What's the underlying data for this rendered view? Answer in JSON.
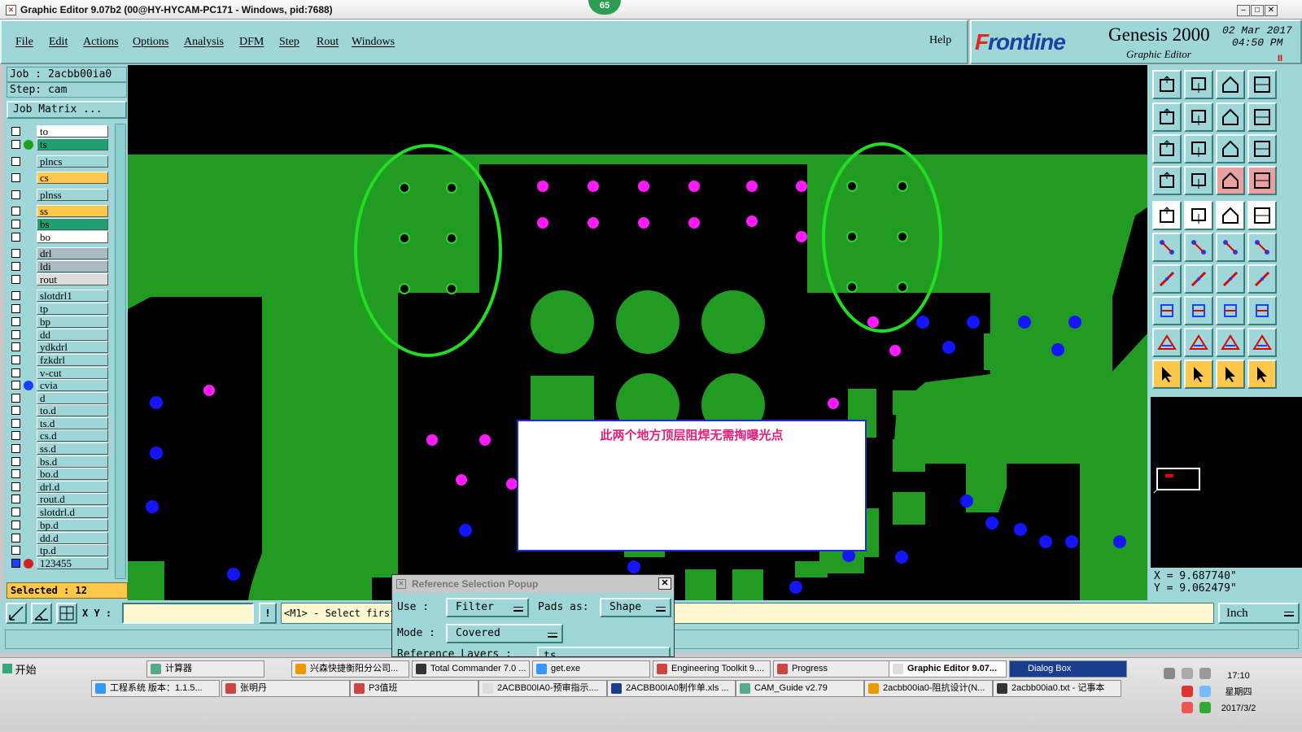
{
  "window": {
    "title": "Graphic Editor 9.07b2 (00@HY-HYCAM-PC171 - Windows, pid:7688)",
    "badge": "65"
  },
  "menu": [
    "File",
    "Edit",
    "Actions",
    "Options",
    "Analysis",
    "DFM",
    "Step",
    "Rout",
    "Windows"
  ],
  "help": "Help",
  "brand": {
    "logo_prefix": "F",
    "logo_rest": "rontline",
    "product": "Genesis 2000",
    "subtitle": "Graphic Editor",
    "date": "02 Mar 2017",
    "time": "04:50 PM",
    "pause": "II"
  },
  "job": {
    "job": "Job : 2acbb00ia0",
    "step": "Step: cam",
    "matrix": "Job Matrix ..."
  },
  "layers": [
    {
      "name": "to",
      "bg": "#ffffff",
      "dot": "",
      "edit": true
    },
    {
      "name": "ts",
      "bg": "#20a070",
      "dot": "#20a020",
      "edit": false
    },
    {
      "name": "plncs",
      "bg": "#9fd7d8",
      "dot": "",
      "edit": false
    },
    {
      "name": "cs",
      "bg": "#ffc84a",
      "dot": "",
      "edit": true
    },
    {
      "name": "plnss",
      "bg": "#9fd7d8",
      "dot": "",
      "edit": false
    },
    {
      "name": "ss",
      "bg": "#ffc84a",
      "dot": "",
      "edit": false
    },
    {
      "name": "bs",
      "bg": "#20a070",
      "dot": "",
      "edit": false
    },
    {
      "name": "bo",
      "bg": "#ffffff",
      "dot": "",
      "edit": false
    },
    {
      "name": "drl",
      "bg": "#a9bcc4",
      "dot": "",
      "edit": false
    },
    {
      "name": "ldi",
      "bg": "#a9bcc4",
      "dot": "",
      "edit": false
    },
    {
      "name": "rout",
      "bg": "#dcdcdc",
      "dot": "",
      "edit": false
    },
    {
      "name": "slotdrl1",
      "bg": "#9fd7d8",
      "dot": "",
      "edit": false
    },
    {
      "name": "tp",
      "bg": "#9fd7d8",
      "dot": "",
      "edit": false
    },
    {
      "name": "bp",
      "bg": "#9fd7d8",
      "dot": "",
      "edit": false
    },
    {
      "name": "dd",
      "bg": "#9fd7d8",
      "dot": "",
      "edit": false
    },
    {
      "name": "ydkdrl",
      "bg": "#9fd7d8",
      "dot": "",
      "edit": false
    },
    {
      "name": "fzkdrl",
      "bg": "#9fd7d8",
      "dot": "",
      "edit": false
    },
    {
      "name": "v-cut",
      "bg": "#9fd7d8",
      "dot": "",
      "edit": false
    },
    {
      "name": "cvia",
      "bg": "#9fd7d8",
      "dot": "#1a3fff",
      "edit": false
    },
    {
      "name": "d",
      "bg": "#9fd7d8",
      "dot": "",
      "edit": false
    },
    {
      "name": "to.d",
      "bg": "#9fd7d8",
      "dot": "",
      "edit": true
    },
    {
      "name": "ts.d",
      "bg": "#9fd7d8",
      "dot": "",
      "edit": false
    },
    {
      "name": "cs.d",
      "bg": "#9fd7d8",
      "dot": "",
      "edit": true
    },
    {
      "name": "ss.d",
      "bg": "#9fd7d8",
      "dot": "",
      "edit": false
    },
    {
      "name": "bs.d",
      "bg": "#9fd7d8",
      "dot": "",
      "edit": false
    },
    {
      "name": "bo.d",
      "bg": "#9fd7d8",
      "dot": "",
      "edit": false
    },
    {
      "name": "drl.d",
      "bg": "#9fd7d8",
      "dot": "",
      "edit": false
    },
    {
      "name": "rout.d",
      "bg": "#9fd7d8",
      "dot": "",
      "edit": false
    },
    {
      "name": "slotdrl.d",
      "bg": "#9fd7d8",
      "dot": "",
      "edit": false
    },
    {
      "name": "bp.d",
      "bg": "#9fd7d8",
      "dot": "",
      "edit": false
    },
    {
      "name": "dd.d",
      "bg": "#9fd7d8",
      "dot": "",
      "edit": false
    },
    {
      "name": "tp.d",
      "bg": "#9fd7d8",
      "dot": "",
      "edit": false
    },
    {
      "name": "123455",
      "bg": "#9fd7d8",
      "dot": "#d42020",
      "edit": false
    }
  ],
  "selected": "Selected : 12",
  "callout": "此两个地方顶层阻焊无需掏曝光点",
  "coords": {
    "x": "X = 9.687740\"",
    "y": "Y = 9.062479\""
  },
  "status": {
    "xy_label": "X Y :",
    "xy_value": "",
    "info": "!",
    "prompt": "<M1> - Select first",
    "units": "Inch"
  },
  "popup": {
    "title": "Reference Selection Popup",
    "use_label": "Use :",
    "use_value": "Filter",
    "pads_label": "Pads as:",
    "pads_value": "Shape",
    "mode_label": "Mode :",
    "mode_value": "Covered",
    "ref_label": "Reference Layers :",
    "ref_value": "ts"
  },
  "taskbar": {
    "start": "开始",
    "row1": [
      "计算器",
      "兴森快捷衡阳分公司...",
      "Total Commander 7.0 ...",
      "get.exe",
      "Engineering Toolkit 9....",
      "Progress",
      "Graphic Editor 9.07...",
      "Dialog Box"
    ],
    "row2": [
      "工程系统  版本：1.1.5...",
      "张明丹",
      "P3值班",
      "2ACBB00IA0-预审指示....",
      "2ACBB00IA0制作单.xls ...",
      "CAM_Guide v2.79",
      "2acbb00ia0-阻抗设计(N...",
      "2acbb00ia0.txt - 记事本"
    ],
    "clock_time": "17:10",
    "clock_day": "星期四",
    "clock_date": "2017/3/2"
  },
  "colors": {
    "board_green": "#219b21",
    "pad_magenta": "#ff1aff",
    "pad_blue": "#1414ff",
    "pad_green_outline": "#30d030",
    "ellipse_green": "#22dd22",
    "panel_teal": "#9fd7d8"
  }
}
